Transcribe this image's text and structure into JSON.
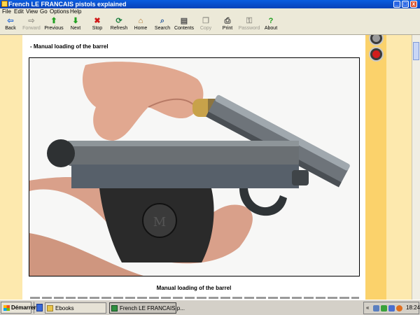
{
  "window": {
    "title": "French LE FRANCAIS pistols explained",
    "buttons": {
      "minimize": "_",
      "maximize": "□",
      "close": "x"
    }
  },
  "menu": {
    "items": [
      "File",
      "Edit",
      "View",
      "Go",
      "Options",
      "Help"
    ]
  },
  "toolbar": {
    "buttons": [
      {
        "label": "Back",
        "icon": "back-arrow-icon",
        "enabled": true
      },
      {
        "label": "Forward",
        "icon": "forward-arrow-icon",
        "enabled": false
      },
      {
        "label": "Previous",
        "icon": "up-arrow-icon",
        "enabled": true
      },
      {
        "label": "Next",
        "icon": "down-arrow-icon",
        "enabled": true
      },
      {
        "label": "Stop",
        "icon": "stop-icon",
        "enabled": true
      },
      {
        "label": "Refresh",
        "icon": "refresh-icon",
        "enabled": true
      },
      {
        "label": "Home",
        "icon": "home-icon",
        "enabled": true
      },
      {
        "label": "Search",
        "icon": "search-icon",
        "enabled": true
      },
      {
        "label": "Contents",
        "icon": "contents-icon",
        "enabled": true
      },
      {
        "label": "Copy",
        "icon": "copy-icon",
        "enabled": false
      },
      {
        "label": "Print",
        "icon": "print-icon",
        "enabled": true
      },
      {
        "label": "Password",
        "icon": "key-icon",
        "enabled": false
      },
      {
        "label": "About",
        "icon": "help-icon",
        "enabled": true
      }
    ]
  },
  "page": {
    "section_heading": "- Manual loading of the barrel",
    "photo_caption": "Manual loading of the barrel",
    "side_buttons": [
      "up-nav-icon",
      "red-arrow-nav-icon"
    ]
  },
  "taskbar": {
    "start_label": "Démarrer",
    "tasks": [
      {
        "label": "Ebooks",
        "active": false
      },
      {
        "label": "French LE FRANCAIS p...",
        "active": true
      }
    ],
    "tray": {
      "expander": "«",
      "clock": "18:24"
    }
  },
  "colors": {
    "titlebar": "#0a5de0",
    "page_background": "#ffffff",
    "side_band": "#fbd26b",
    "outer_band": "#fde9ae"
  }
}
